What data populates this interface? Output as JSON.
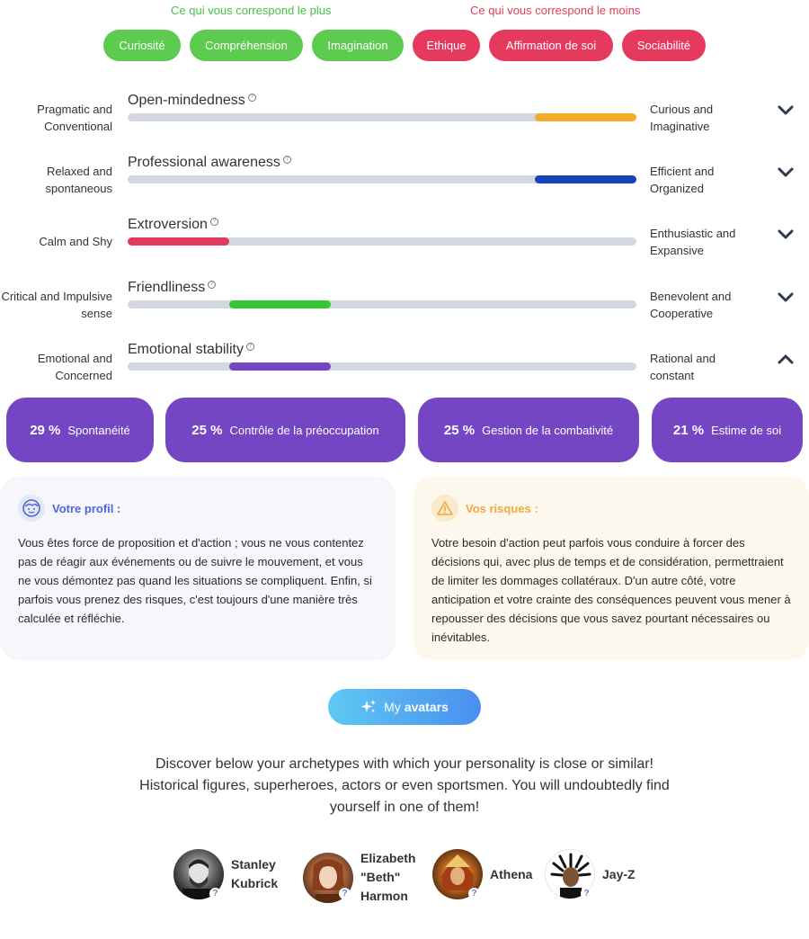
{
  "headers": {
    "plus": "Ce qui vous correspond le plus",
    "moins": "Ce qui vous correspond le moins"
  },
  "pills_green": [
    "Curiosité",
    "Compréhension",
    "Imagination"
  ],
  "pills_red": [
    "Ethique",
    "Affirmation de soi",
    "Sociabilité"
  ],
  "traits": [
    {
      "left": "Pragmatic and Conventional",
      "title": "Open-mindedness",
      "right": "Curious and Imaginative",
      "range": [
        0.8,
        1.0
      ],
      "color": "#f4ac2d",
      "expanded": false
    },
    {
      "left": "Relaxed and spontaneous",
      "title": "Professional awareness",
      "right": "Efficient and Organized",
      "range": [
        0.8,
        1.0
      ],
      "color": "#1844b8",
      "expanded": false
    },
    {
      "left": "Calm and Shy",
      "title": "Extroversion",
      "right": "Enthusiastic and Expansive",
      "range": [
        0.0,
        0.2
      ],
      "color": "#e13a5f",
      "expanded": false
    },
    {
      "left": "Critical and Impulsive sense",
      "title": "Friendliness",
      "right": "Benevolent and Cooperative",
      "range": [
        0.2,
        0.4
      ],
      "color": "#34c733",
      "expanded": false
    },
    {
      "left": "Emotional and Concerned",
      "title": "Emotional stability",
      "right": "Rational and constant",
      "range": [
        0.2,
        0.4
      ],
      "color": "#7446c3",
      "expanded": true
    }
  ],
  "facets": [
    {
      "pct": "29 %",
      "name": "Spontanéité"
    },
    {
      "pct": "25 %",
      "name": "Contrôle de la préoccupation"
    },
    {
      "pct": "25 %",
      "name": "Gestion de la combativité"
    },
    {
      "pct": "21 %",
      "name": "Estime de soi"
    }
  ],
  "profile": {
    "title": "Votre profil :",
    "text": "Vous êtes force de proposition et d'action ; vous ne vous contentez pas de réagir aux événements ou de suivre le mouvement, et vous ne vous démontez pas quand les situations se compliquent. Enfin, si parfois vous prenez des risques, c'est toujours d'une manière très calculée et réfléchie."
  },
  "risks": {
    "title": "Vos risques :",
    "text": "Votre besoin d'action peut parfois vous conduire à forcer des décisions qui, avec plus de temps et de considération, permettraient de limiter les dommages collatéraux. D'un autre côté, votre anticipation et votre crainte des conséquences peuvent vous mener à repousser des décisions que vous savez pourtant nécessaires ou inévitables."
  },
  "avatars_button": {
    "prefix": "My",
    "bold": "avatars"
  },
  "discover_text": "Discover below your archetypes with which your personality is close or similar! Historical figures, superheroes, actors or even sportsmen. You will undoubtedly find yourself in one of them!",
  "avatars": [
    {
      "name": "Stanley Kubrick",
      "icon": "portrait-kubrick"
    },
    {
      "name": "Elizabeth \"Beth\" Harmon",
      "icon": "portrait-harmon"
    },
    {
      "name": "Athena",
      "icon": "portrait-athena"
    },
    {
      "name": "Jay-Z",
      "icon": "portrait-jayz"
    }
  ],
  "colors": {
    "green": "#5ccb4f",
    "red": "#e53a5e",
    "purple": "#7446c3"
  }
}
